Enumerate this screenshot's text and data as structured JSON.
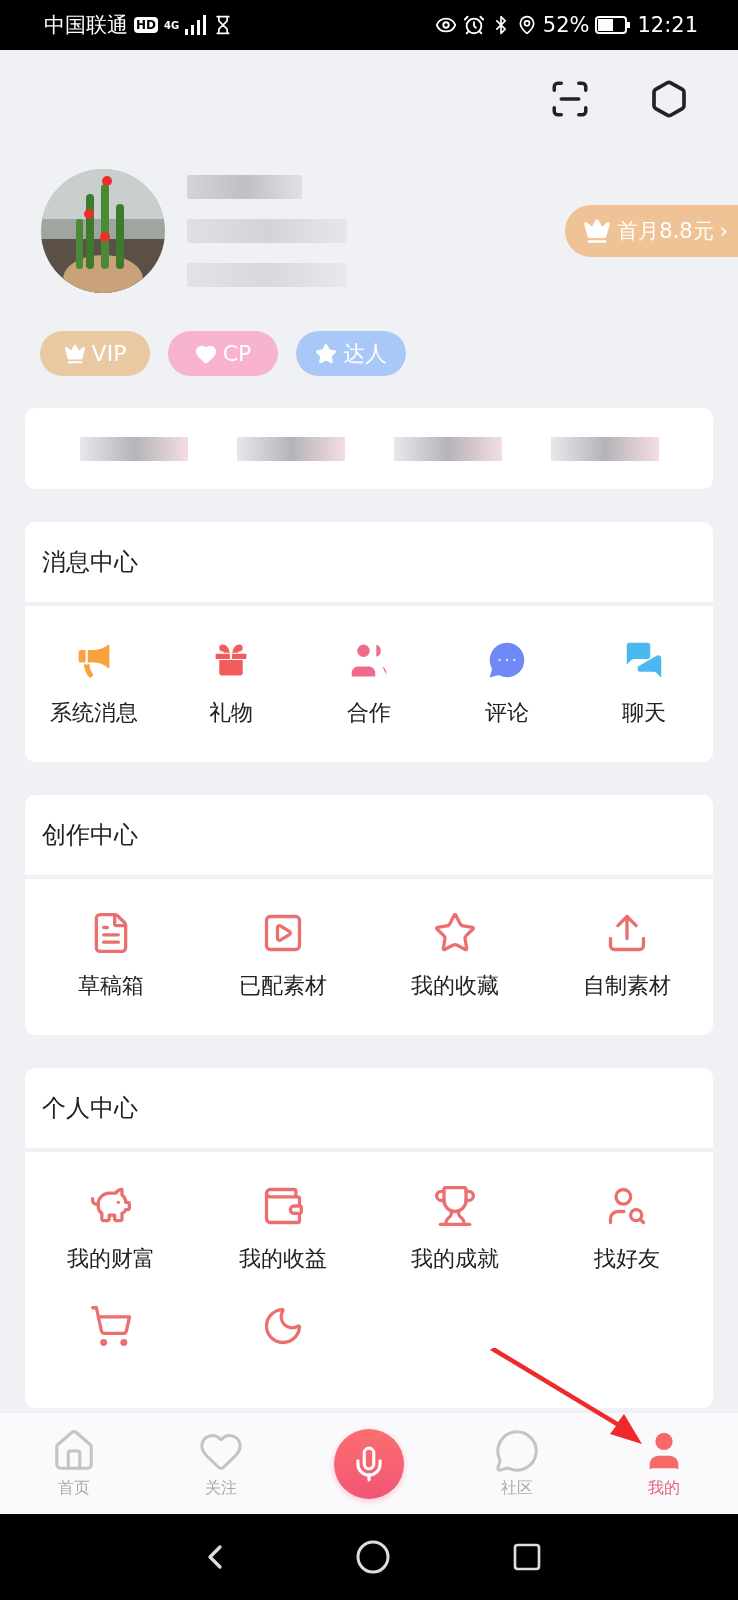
{
  "status_bar": {
    "carrier": "中国联通",
    "network_badge": "HD",
    "network_type": "4G",
    "battery": "52%",
    "time": "12:21"
  },
  "profile": {
    "promo": "首月8.8元",
    "promo_arrow": "›"
  },
  "tags": [
    {
      "label": "VIP",
      "color": "#e9c9a2"
    },
    {
      "label": "CP",
      "color": "#f7b3cf"
    },
    {
      "label": "达人",
      "color": "#a9c8f7"
    }
  ],
  "sections": [
    {
      "title": "消息中心",
      "kind": "filled",
      "items": [
        "系统消息",
        "礼物",
        "合作",
        "评论",
        "聊天"
      ]
    },
    {
      "title": "创作中心",
      "kind": "outline",
      "items": [
        "草稿箱",
        "已配素材",
        "我的收藏",
        "自制素材"
      ]
    },
    {
      "title": "个人中心",
      "kind": "outline",
      "items": [
        "我的财富",
        "我的收益",
        "我的成就",
        "找好友"
      ]
    }
  ],
  "nav": [
    {
      "kind": "tab",
      "label": "首页",
      "selected": false
    },
    {
      "kind": "tab",
      "label": "关注",
      "selected": false
    },
    {
      "kind": "record"
    },
    {
      "kind": "tab",
      "label": "社区",
      "selected": false
    },
    {
      "kind": "tab",
      "label": "我的",
      "selected": true
    }
  ]
}
